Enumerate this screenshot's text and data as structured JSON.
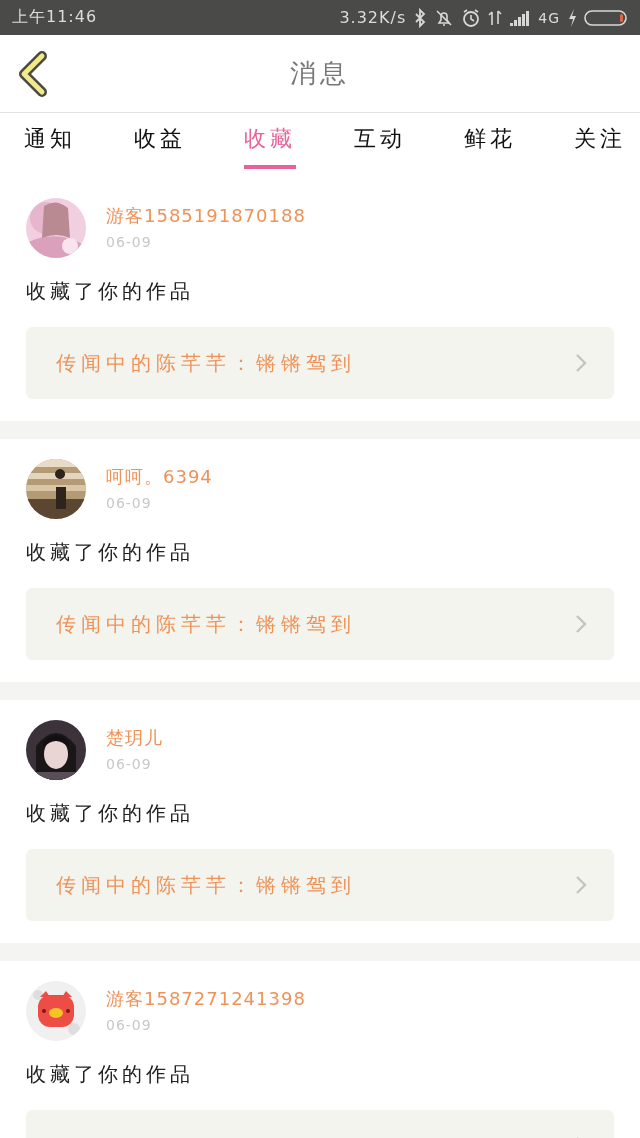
{
  "status_bar": {
    "time": "上午11:46",
    "speed": "3.32K/s",
    "network": "4G"
  },
  "header": {
    "title": "消息"
  },
  "tabs": [
    {
      "label": "通知",
      "selected": false
    },
    {
      "label": "收益",
      "selected": false
    },
    {
      "label": "收藏",
      "selected": true
    },
    {
      "label": "互动",
      "selected": false
    },
    {
      "label": "鲜花",
      "selected": false
    },
    {
      "label": "关注",
      "selected": false
    }
  ],
  "messages": [
    {
      "user": "游客1585191870188",
      "date": "06-09",
      "action": "收藏了你的作品",
      "work": "传闻中的陈芊芊：锵锵驾到"
    },
    {
      "user": "呵呵。6394",
      "date": "06-09",
      "action": "收藏了你的作品",
      "work": "传闻中的陈芊芊：锵锵驾到"
    },
    {
      "user": "楚玥儿",
      "date": "06-09",
      "action": "收藏了你的作品",
      "work": "传闻中的陈芊芊：锵锵驾到"
    },
    {
      "user": "游客1587271241398",
      "date": "06-09",
      "action": "收藏了你的作品"
    }
  ]
}
